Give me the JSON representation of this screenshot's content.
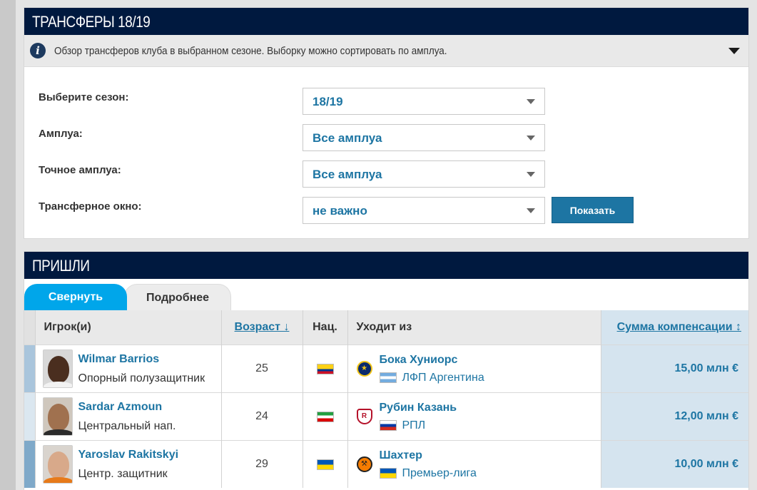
{
  "transfers_box": {
    "title": "ТРАНСФЕРЫ 18/19",
    "info_text": "Обзор трансферов клуба в выбранном сезоне. Выборку можно сортировать по амплуа.",
    "filters": [
      {
        "label": "Выберите сезон:",
        "value": "18/19"
      },
      {
        "label": "Амплуа:",
        "value": "Все амплуа"
      },
      {
        "label": "Точное амплуа:",
        "value": "Все амплуа"
      },
      {
        "label": "Трансферное окно:",
        "value": "не важно"
      }
    ],
    "show_button": "Показать"
  },
  "arrivals": {
    "title": "ПРИШЛИ",
    "tabs": [
      "Свернуть",
      "Подробнее"
    ],
    "columns": [
      "Игрок(и)",
      "Возраст ↓",
      "Нац.",
      "Уходит из",
      "Сумма компенсации ↕"
    ],
    "rows": [
      {
        "name": "Wilmar Barrios",
        "position": "Опорный полузащитник",
        "age": "25",
        "nat_flag": "colombia",
        "from_club": "Бока Хуниорс",
        "league": "ЛФП Аргентина",
        "league_flag": "argentina",
        "fee": "15,00 млн €",
        "marker_color": "#a9c5dc"
      },
      {
        "name": "Sardar Azmoun",
        "position": "Центральный нап.",
        "age": "24",
        "nat_flag": "iran",
        "from_club": "Рубин Казань",
        "league": "РПЛ",
        "league_flag": "russia",
        "fee": "12,00 млн €",
        "marker_color": "#dbe7f0"
      },
      {
        "name": "Yaroslav Rakitskyi",
        "position": "Центр. защитник",
        "age": "29",
        "nat_flag": "ukraine",
        "from_club": "Шахтер",
        "league": "Премьер-лига",
        "league_flag": "ukraine",
        "fee": "10,00 млн €",
        "marker_color": "#7fa9c9"
      }
    ]
  }
}
